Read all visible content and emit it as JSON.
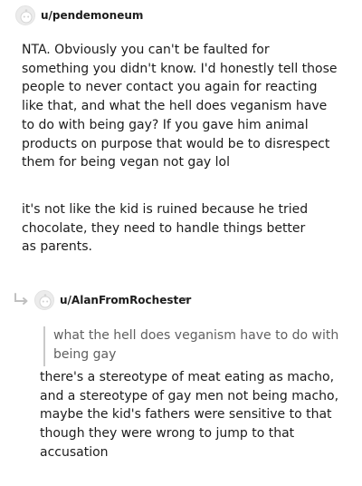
{
  "comment1": {
    "username": "u/pendemoneum",
    "separator": "•",
    "paragraph1": "NTA. Obviously you can't be faulted for something you didn't know. I'd honestly tell those people to never contact you again for reacting like that, and what the hell does veganism have to do with being gay? If you gave him animal products on purpose that would be to disrespect them for being vegan not gay lol",
    "paragraph2": "it's not like the kid is ruined because he tried chocolate, they need to handle things better as parents."
  },
  "comment2": {
    "username": "u/AlanFromRochester",
    "separator": "•",
    "quote": "what the hell does veganism have to do with being gay",
    "body": "there's a stereotype of meat eating as macho, and a stereotype of gay men not being macho, maybe the kid's fathers were sensitive to that though they were wrong to jump to that accusation"
  },
  "icons": {
    "avatar": "snoo-avatar-icon",
    "reply": "reply-arrow-icon"
  },
  "colors": {
    "text": "#1c1c1c",
    "quote_text": "#5f5f5f",
    "quote_bar": "#c9c9c9",
    "meta": "#7c7c7c"
  }
}
